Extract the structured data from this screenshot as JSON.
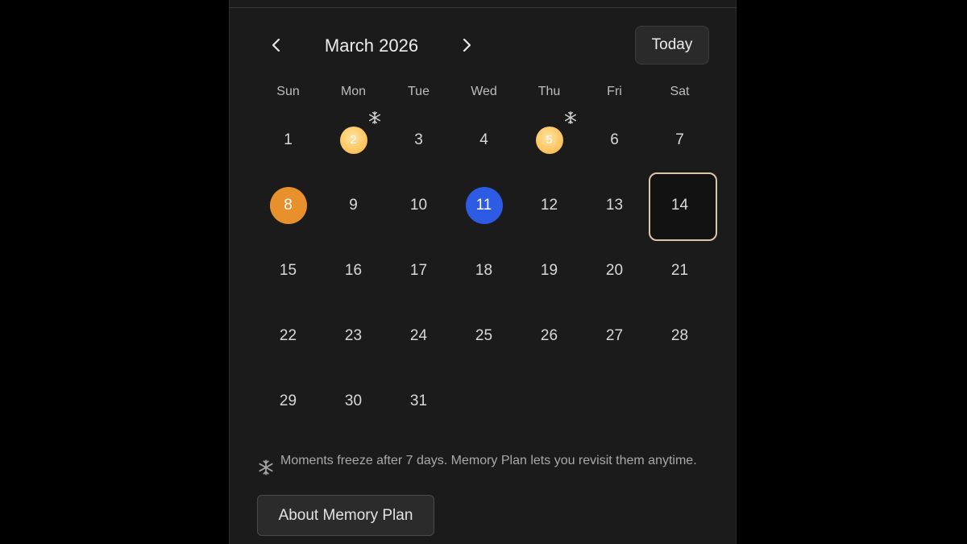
{
  "calendar": {
    "month_title": "March 2026",
    "today_label": "Today",
    "weekdays": [
      "Sun",
      "Mon",
      "Tue",
      "Wed",
      "Thu",
      "Fri",
      "Sat"
    ],
    "days": [
      "1",
      "2",
      "3",
      "4",
      "5",
      "6",
      "7",
      "8",
      "9",
      "10",
      "11",
      "12",
      "13",
      "14",
      "15",
      "16",
      "17",
      "18",
      "19",
      "20",
      "21",
      "22",
      "23",
      "24",
      "25",
      "26",
      "27",
      "28",
      "29",
      "30",
      "31"
    ],
    "moment_days": [
      "2",
      "5"
    ],
    "frozen_days": [
      "2",
      "5"
    ],
    "orange_day": "8",
    "today_day": "11",
    "selected_day": "14",
    "colors": {
      "orange": "#e8902c",
      "blue": "#2d5be3",
      "moment_gold": "#fcc866",
      "selected_border": "#d8c7a8"
    }
  },
  "footer": {
    "info_icon": "snowflake-icon",
    "info_text": "Moments freeze after 7 days. Memory Plan lets you revisit them anytime.",
    "about_label": "About Memory Plan"
  },
  "icons": {
    "prev": "chevron-left-icon",
    "next": "chevron-right-icon",
    "freeze": "snowflake-icon"
  }
}
